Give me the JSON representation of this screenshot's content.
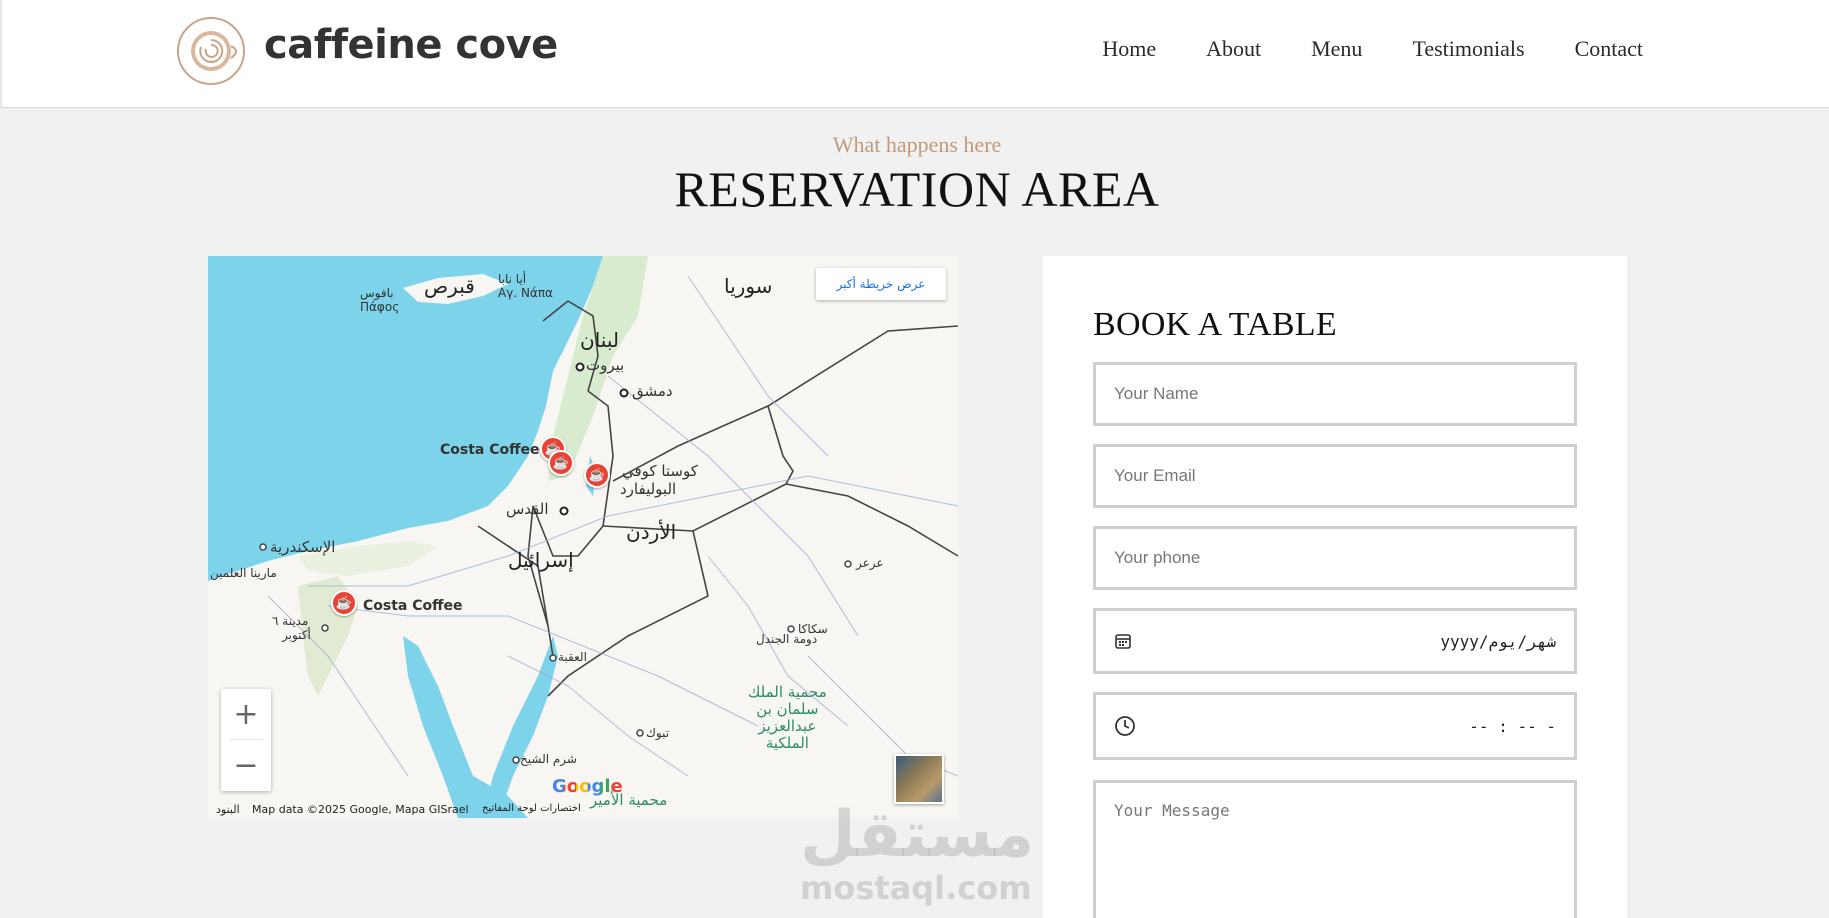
{
  "header": {
    "brand": "caffeine cove",
    "nav": [
      "Home",
      "About",
      "Menu",
      "Testimonials",
      "Contact"
    ]
  },
  "section": {
    "eyebrow": "What happens here",
    "title": "RESERVATION AREA"
  },
  "map": {
    "view_larger": "عرض خريطة أكبر",
    "zoom_in": "+",
    "zoom_out": "−",
    "google": "Google",
    "attribution": "Map data ©2025 Google, Mapa GISrael",
    "shortcuts": "اختصارات لوحة المفاتيح",
    "terms": "البنود",
    "labels": {
      "syria": "سوريا",
      "lebanon": "لبنان",
      "beirut": "بيروت",
      "damascus": "دمشق",
      "cyprus": "قبرص",
      "ayia_napa_ar": "أيا نابا",
      "ayia_napa_gr": "Αγ. Νάπα",
      "paphos_ar": "بافوس",
      "paphos_gr": "Πάφος",
      "costa_coffee_1": "Costa Coffee",
      "costa_boulevard_1": "كوستا كوفي",
      "costa_boulevard_2": "البوليفارد",
      "jerusalem": "القدس",
      "jordan": "الأردن",
      "israel": "إسرائيل",
      "alexandria": "الإسكندرية",
      "marina": "مارينا العلمين",
      "costa_coffee_2": "Costa Coffee",
      "october_1": "مدينة ٦",
      "october_2": "أكتوبر",
      "aqaba": "العقبة",
      "dumat": "دومة الجندل",
      "sakaka": "سكاكا",
      "arar": "عرعر",
      "tabuk": "تبوك",
      "sharm": "شرم الشيخ",
      "reserve_1": "محمية الملك",
      "reserve_2": "سلمان بن",
      "reserve_3": "عبدالعزيز",
      "reserve_4": "الملكية",
      "reserve_b": "محمية الأمير"
    },
    "colors": {
      "water": "#7dd3ea",
      "land": "#f8f6f2",
      "green": "#cfe9c6",
      "pin": "#ea4335"
    }
  },
  "form": {
    "title": "BOOK A TABLE",
    "name_placeholder": "Your Name",
    "email_placeholder": "Your Email",
    "phone_placeholder": "Your phone",
    "date_value": "yyyy/شهر/يوم",
    "time_value": "-- : -- -",
    "message_placeholder": "Your Message"
  },
  "watermark": {
    "arabic": "مستقل",
    "latin": "mostaql.com"
  }
}
